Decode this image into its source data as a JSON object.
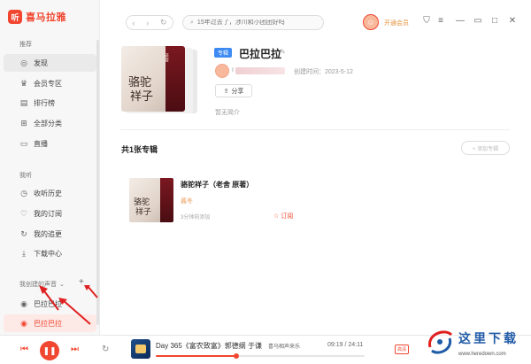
{
  "app": {
    "logo_glyph": "听",
    "name": "喜马拉雅"
  },
  "sidebar": {
    "section_recommend": "推荐",
    "recommend_items": [
      {
        "label": "发现",
        "icon": "discover-icon"
      },
      {
        "label": "会员专区",
        "icon": "vip-icon"
      },
      {
        "label": "排行榜",
        "icon": "rank-icon"
      },
      {
        "label": "全部分类",
        "icon": "category-icon"
      },
      {
        "label": "直播",
        "icon": "live-icon"
      }
    ],
    "section_mine": "我听",
    "mine_items": [
      {
        "label": "收听历史",
        "icon": "history-icon"
      },
      {
        "label": "我的订阅",
        "icon": "subscribe-icon"
      },
      {
        "label": "我的追更",
        "icon": "follow-icon"
      },
      {
        "label": "下载中心",
        "icon": "download-icon"
      }
    ],
    "section_created": "我创建的声音",
    "created_items": [
      {
        "label": "巴拉巴拉",
        "icon": "album-icon"
      },
      {
        "label": "巴拉巴拉",
        "icon": "album-icon"
      }
    ]
  },
  "topbar": {
    "search_placeholder": "15年过去了，涉川和小团团好吗",
    "vip_label": "开通会员"
  },
  "album": {
    "tag": "专辑",
    "title": "巴拉巴拉",
    "creator_initial": "I",
    "created_at": "创建时间：2023-5-12",
    "share_label": "分享",
    "intro": "暂无简介",
    "cover_title_1": "骆驼",
    "cover_title_2": "祥子",
    "cover_small": "老舍"
  },
  "albums_section": {
    "count_label": "共1张专辑",
    "add_label": "+ 添加专辑",
    "items": [
      {
        "title": "骆驼祥子（老舍 原著）",
        "subtitle": "酱冬",
        "time": "3分钟前添加",
        "subscribe_label": "☆ 订阅",
        "cover_title_1": "骆驼",
        "cover_title_2": "祥子"
      }
    ]
  },
  "player": {
    "track_title": "Day 365《富农致富》郭德纲 于谦",
    "author": "喜马相声来乐",
    "time": "09:19 / 24:11",
    "progress": 0.385,
    "quality": "高清"
  },
  "watermark": {
    "text": "这里下载",
    "url": "www.heredown.com"
  },
  "colors": {
    "accent": "#f1462f",
    "tag_blue": "#3d8bf2",
    "vip_orange": "#e6923c"
  }
}
